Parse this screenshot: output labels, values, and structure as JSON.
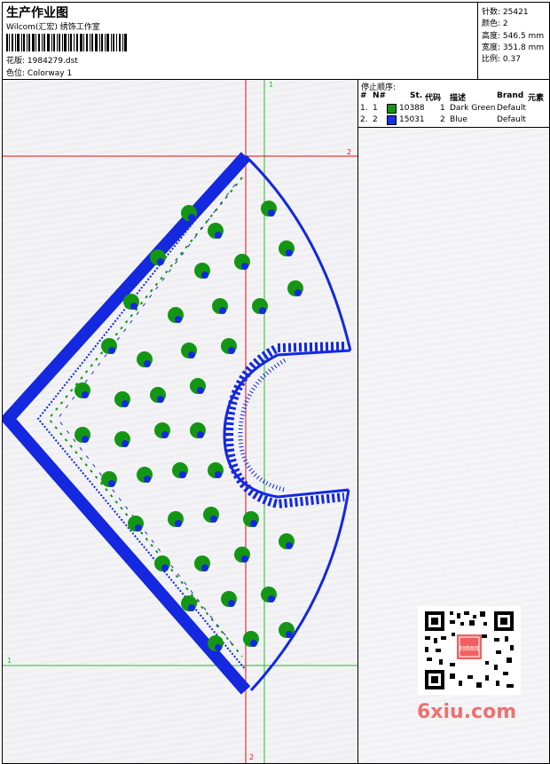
{
  "header": {
    "title": "生产作业图",
    "studio": "Wilcom(汇宏) 绣饰工作室",
    "design_label": "花版:",
    "design_file": "1984279.dst",
    "colorway_label": "色位:",
    "colorway": "Colorway 1"
  },
  "stats": {
    "stitches_label": "针数:",
    "stitches": "25421",
    "colors_label": "颜色:",
    "colors": "2",
    "height_label": "高度:",
    "height": "546.5 mm",
    "width_label": "宽度:",
    "width": "351.8 mm",
    "scale_label": "比例:",
    "scale": "0.37"
  },
  "stop_sequence": {
    "title": "停止顺序:",
    "columns": [
      "#",
      "N#",
      "St.",
      "代码",
      "描述",
      "Brand",
      "元素"
    ],
    "rows": [
      {
        "idx": "1.",
        "needle": "1",
        "stitches": "10388",
        "code": "1",
        "desc": "Dark Green",
        "brand": "Default",
        "color": "#149614"
      },
      {
        "idx": "2.",
        "needle": "2",
        "stitches": "15031",
        "code": "2",
        "desc": "Blue",
        "brand": "Default",
        "color": "#1432e6"
      }
    ]
  },
  "guides": {
    "green_v_label": "1",
    "green_h_label": "1",
    "red_h_label": "2",
    "red_v_label": "2"
  },
  "colors": {
    "thread_green": "#149614",
    "thread_blue": "#1428e0",
    "guide_red": "#e01010",
    "guide_green": "#20c020"
  },
  "watermark": "6xiu.com",
  "qr_stamp": "刺绣图库"
}
